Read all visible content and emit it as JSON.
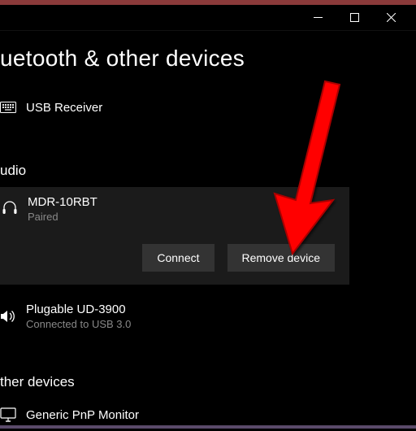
{
  "titlebar": {
    "minimize_icon": "minimize",
    "maximize_icon": "maximize",
    "close_icon": "close"
  },
  "page": {
    "title": "uetooth & other devices"
  },
  "sections": {
    "audio_heading": "udio",
    "other_heading": "ther devices"
  },
  "devices": {
    "usb_receiver": {
      "name": "USB Receiver"
    },
    "headphones": {
      "name": "MDR-10RBT",
      "status": "Paired"
    },
    "plugable": {
      "name": "Plugable UD-3900",
      "status": "Connected to USB 3.0"
    },
    "monitor": {
      "name": "Generic PnP Monitor"
    }
  },
  "buttons": {
    "connect": "Connect",
    "remove": "Remove device"
  }
}
